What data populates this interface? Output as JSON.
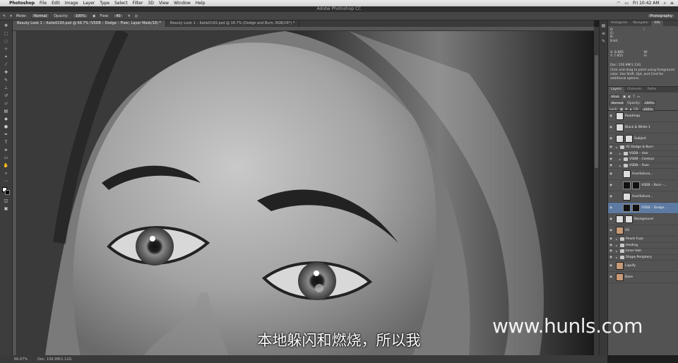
{
  "menubar": {
    "app": "Photoshop",
    "items": [
      "File",
      "Edit",
      "Image",
      "Layer",
      "Type",
      "Select",
      "Filter",
      "3D",
      "View",
      "Window",
      "Help"
    ],
    "clock": "Fri 10:42 AM"
  },
  "window_title": "Adobe Photoshop CC",
  "options_bar": {
    "mode_label": "Mode:",
    "mode_value": "Normal",
    "opacity_label": "Opacity:",
    "opacity_value": "100%",
    "flow_label": "Flow:",
    "flow_value": "40",
    "workspace": "Photography"
  },
  "doc_tabs": [
    "Beauty Look 1 – Katie0193.psd @ 66.7% (VSDB – Dodge – Fixer, Layer Mask/16) *",
    "Beauty Look 1 – Katie0193.psd @ 16.7% (Dodge and Burn, RGB/16*) *"
  ],
  "status": {
    "zoom": "66.67%",
    "doc_size": "Doc: 156.9M/1.12G"
  },
  "panels": {
    "top_tabs": [
      "Histogram",
      "Navigator",
      "Info"
    ],
    "info": {
      "r": "R:",
      "g": "G:",
      "b": "B:",
      "x": "X:",
      "y": "Y:",
      "x_val": "8.885",
      "y_val": "7.955",
      "w": "W:",
      "h": "H:",
      "bit": "8-bit",
      "doc": "Doc: 156.9M/1.12G",
      "tip": "Click and drag to paint using foreground color. Use Shift, Opt, and Cmd for additional options."
    },
    "layer_tabs": [
      "Layers",
      "Channels",
      "Paths"
    ],
    "kind": "Kind",
    "blend": "Normal",
    "opacity_label": "Opacity:",
    "opacity": "100%",
    "lock_label": "Lock:",
    "fill_label": "Fill:",
    "fill": "100%",
    "layers": [
      {
        "name": "Roadmap",
        "type": "white",
        "indent": 0
      },
      {
        "name": "Black & White 1",
        "type": "white",
        "indent": 0
      },
      {
        "name": "Subject",
        "type": "mask",
        "indent": 0
      },
      {
        "name": "VE Dodge & Burn",
        "type": "group",
        "indent": 0
      },
      {
        "name": "VSDB – Hair",
        "type": "group",
        "indent": 1
      },
      {
        "name": "VSDB – Contour",
        "type": "group",
        "indent": 1
      },
      {
        "name": "VSDB – Fixer",
        "type": "group",
        "indent": 1
      },
      {
        "name": "Hue/Satura...",
        "type": "white",
        "indent": 2
      },
      {
        "name": "VSDB – Burn –...",
        "type": "black",
        "indent": 2
      },
      {
        "name": "Hue/Satura...",
        "type": "white",
        "indent": 2
      },
      {
        "name": "VSDB – Dodge...",
        "type": "black",
        "indent": 2,
        "selected": true
      },
      {
        "name": "Background",
        "type": "mask",
        "indent": 0
      },
      {
        "name": "VS",
        "type": "face",
        "indent": 0
      },
      {
        "name": "Peach Fuzz",
        "type": "group",
        "indent": 0
      },
      {
        "name": "Healing",
        "type": "group",
        "indent": 0
      },
      {
        "name": "Inner Hair",
        "type": "group",
        "indent": 0
      },
      {
        "name": "Shape Periphery",
        "type": "group",
        "indent": 0
      },
      {
        "name": "Liquify",
        "type": "face",
        "indent": 0
      },
      {
        "name": "Base",
        "type": "face",
        "indent": 0
      }
    ]
  },
  "watermark": "www.hunls.com",
  "subtitle": "本地躲闪和燃烧，所以我"
}
